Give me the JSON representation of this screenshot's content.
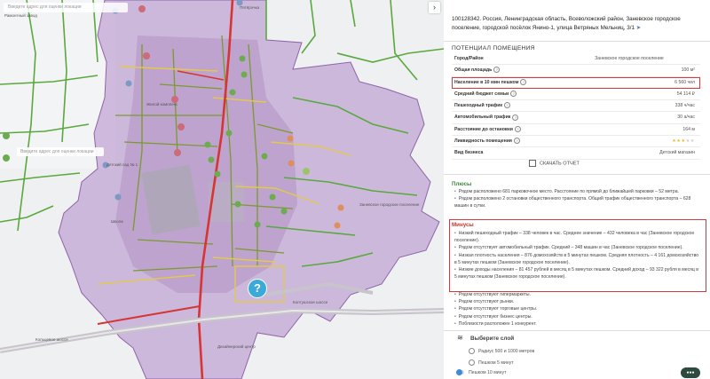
{
  "map": {
    "search_placeholder": "Введите адрес для оценки локации",
    "search2_placeholder": "Введите адрес для оценки локации",
    "labels": [
      "Рамонтный завод",
      "Жилой комплекс",
      "Детский сад № 1",
      "Пятёрочка",
      "Школа",
      "Заневское городское поселение",
      "Кольцевое шоссе",
      "Колтушское шоссе",
      "Дизайнерский центр"
    ],
    "collapse_icon": "chevron-right-icon",
    "badge_icon": "question-icon",
    "badge_text": "?"
  },
  "panel": {
    "address": "100128342. Россия, Ленинградская область, Всеволожский район, Заневское городское поселение, городской посёлок Янино-1, улица Ветряных Мельниц, 3/1",
    "section_title": "ПОТЕНЦИАЛ ПОМЕЩЕНИЯ",
    "rows": [
      {
        "label": "Город/Район",
        "value": "Заневское городское поселение",
        "info": false,
        "align": "center"
      },
      {
        "label": "Общая площадь",
        "value": "100 м²",
        "info": true,
        "align": "right"
      },
      {
        "label": "Население в 10 мин пешком",
        "value": "6 560 чел",
        "info": true,
        "align": "right",
        "highlight": true
      },
      {
        "label": "Средний бюджет семьи",
        "value": "54 114 ₽",
        "info": true,
        "align": "right"
      },
      {
        "label": "Пешеходный трафик",
        "value": "338 ч/час",
        "info": true,
        "align": "right"
      },
      {
        "label": "Автомобильный трафик",
        "value": "30 а/час",
        "info": true,
        "align": "right"
      },
      {
        "label": "Расстояние до остановки",
        "value": "164 м",
        "info": true,
        "align": "right"
      },
      {
        "label": "Ликвидность помещения",
        "value": "",
        "info": true,
        "align": "right",
        "stars": 3,
        "stars_max": 5
      },
      {
        "label": "Вид бизнеса",
        "value": "Детский магазин",
        "info": false,
        "align": "right"
      }
    ],
    "download_label": "СКАЧАТЬ ОТЧЕТ",
    "plus_title": "Плюсы",
    "plus_items": [
      "Рядом расположено 681 парковочное место. Расстояние по прямой до ближайшей парковки – 52 метра.",
      "Рядом расположено 2 остановки общественного транспорта. Общий трафик общественного транспорта – 628 машин в сутки."
    ],
    "minus_title": "Минусы",
    "minus_items": [
      "Низкий пешеходный трафик – 338 человек в час. Среднее значение – 432 человека в час (Заневское городское поселение).",
      "Рядом отсутствует автомобильный трафик. Средний – 348 машин в час (Заневское городское поселение).",
      "Низкая плотность населения – 876 домохозяйств в 5 минутах пешком. Средняя плотность – 4 161 домохозяйство в 5 минутах пешком (Заневское городское поселение).",
      "Низкие доходы населения – 81 457 рублей в месяц в 5 минутах пешком. Средний доход – 93 322 рубля в месяц в 5 минутах пешком (Заневское городское поселение)."
    ],
    "other_items": [
      "Рядом отсутствуют гипермаркеты.",
      "Рядом отсутствуют рынки.",
      "Рядом отсутствуют торговые центры.",
      "Рядом отсутствуют бизнес центры.",
      "Поблизости расположен 1 конкурент."
    ],
    "layer_title": "Выберите слой",
    "layer_options": [
      "Радиус 500 и 1000 метров",
      "Пешком 5 минут",
      "Пешком 10 минут"
    ],
    "chat_label": "●●●",
    "colors": {
      "highlight": "#d23b3b",
      "plus": "#3a8a3a",
      "minus": "#c0392b",
      "isochrone": "#b18bc8"
    }
  }
}
